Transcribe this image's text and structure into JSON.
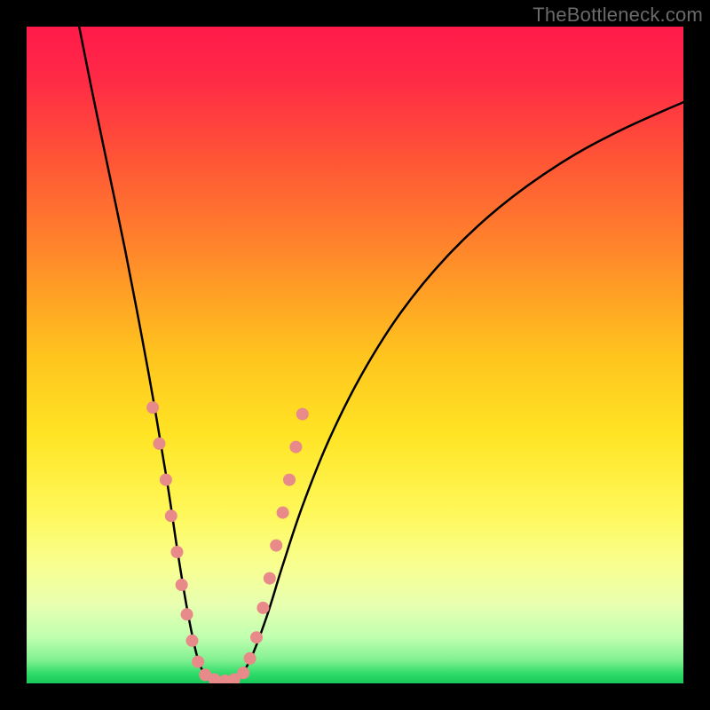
{
  "watermark": {
    "text": "TheBottleneck.com"
  },
  "gradient": {
    "stops": [
      {
        "offset": 0.0,
        "color": "#ff1a4a"
      },
      {
        "offset": 0.08,
        "color": "#ff2a46"
      },
      {
        "offset": 0.2,
        "color": "#ff5436"
      },
      {
        "offset": 0.35,
        "color": "#ff8a2a"
      },
      {
        "offset": 0.5,
        "color": "#ffc41e"
      },
      {
        "offset": 0.62,
        "color": "#ffe424"
      },
      {
        "offset": 0.74,
        "color": "#fff85a"
      },
      {
        "offset": 0.82,
        "color": "#f8ff90"
      },
      {
        "offset": 0.88,
        "color": "#e8ffb0"
      },
      {
        "offset": 0.93,
        "color": "#c0ffb0"
      },
      {
        "offset": 0.965,
        "color": "#80f090"
      },
      {
        "offset": 0.985,
        "color": "#30dc6a"
      },
      {
        "offset": 1.0,
        "color": "#18c85a"
      }
    ]
  },
  "chart_data": {
    "type": "line",
    "title": "",
    "xlabel": "",
    "ylabel": "",
    "xlim": [
      0,
      100
    ],
    "ylim": [
      0,
      100
    ],
    "note": "x and y in percent of plot area; y=100 is top (high bottleneck), y=0 is bottom (no bottleneck). Two curves descend into a flat minimum around x≈26–33 then rise.",
    "series": [
      {
        "name": "left-curve",
        "points": [
          {
            "x": 8.0,
            "y": 100.0
          },
          {
            "x": 10.0,
            "y": 90.0
          },
          {
            "x": 12.5,
            "y": 78.0
          },
          {
            "x": 15.0,
            "y": 66.0
          },
          {
            "x": 17.5,
            "y": 53.0
          },
          {
            "x": 19.5,
            "y": 42.0
          },
          {
            "x": 21.5,
            "y": 30.0
          },
          {
            "x": 23.0,
            "y": 20.0
          },
          {
            "x": 24.5,
            "y": 11.0
          },
          {
            "x": 26.0,
            "y": 4.0
          },
          {
            "x": 27.5,
            "y": 1.0
          },
          {
            "x": 29.5,
            "y": 0.3
          }
        ]
      },
      {
        "name": "right-curve",
        "points": [
          {
            "x": 29.5,
            "y": 0.3
          },
          {
            "x": 32.0,
            "y": 0.8
          },
          {
            "x": 34.0,
            "y": 3.5
          },
          {
            "x": 36.5,
            "y": 10.0
          },
          {
            "x": 39.0,
            "y": 18.0
          },
          {
            "x": 42.0,
            "y": 27.0
          },
          {
            "x": 46.0,
            "y": 37.0
          },
          {
            "x": 51.0,
            "y": 47.0
          },
          {
            "x": 57.0,
            "y": 56.5
          },
          {
            "x": 64.0,
            "y": 65.0
          },
          {
            "x": 72.0,
            "y": 72.5
          },
          {
            "x": 81.0,
            "y": 79.0
          },
          {
            "x": 90.0,
            "y": 84.0
          },
          {
            "x": 100.0,
            "y": 88.5
          }
        ]
      }
    ],
    "markers": {
      "name": "highlighted-points",
      "color": "#e98a8a",
      "radius_px": 7,
      "points": [
        {
          "x": 19.2,
          "y": 42.0
        },
        {
          "x": 20.2,
          "y": 36.5
        },
        {
          "x": 21.2,
          "y": 31.0
        },
        {
          "x": 22.0,
          "y": 25.5
        },
        {
          "x": 22.9,
          "y": 20.0
        },
        {
          "x": 23.6,
          "y": 15.0
        },
        {
          "x": 24.4,
          "y": 10.5
        },
        {
          "x": 25.2,
          "y": 6.5
        },
        {
          "x": 26.1,
          "y": 3.3
        },
        {
          "x": 27.2,
          "y": 1.3
        },
        {
          "x": 28.6,
          "y": 0.6
        },
        {
          "x": 30.2,
          "y": 0.4
        },
        {
          "x": 31.6,
          "y": 0.6
        },
        {
          "x": 33.0,
          "y": 1.6
        },
        {
          "x": 34.0,
          "y": 3.8
        },
        {
          "x": 35.0,
          "y": 7.0
        },
        {
          "x": 36.0,
          "y": 11.5
        },
        {
          "x": 37.0,
          "y": 16.0
        },
        {
          "x": 38.0,
          "y": 21.0
        },
        {
          "x": 39.0,
          "y": 26.0
        },
        {
          "x": 40.0,
          "y": 31.0
        },
        {
          "x": 41.0,
          "y": 36.0
        },
        {
          "x": 42.0,
          "y": 41.0
        }
      ]
    }
  }
}
